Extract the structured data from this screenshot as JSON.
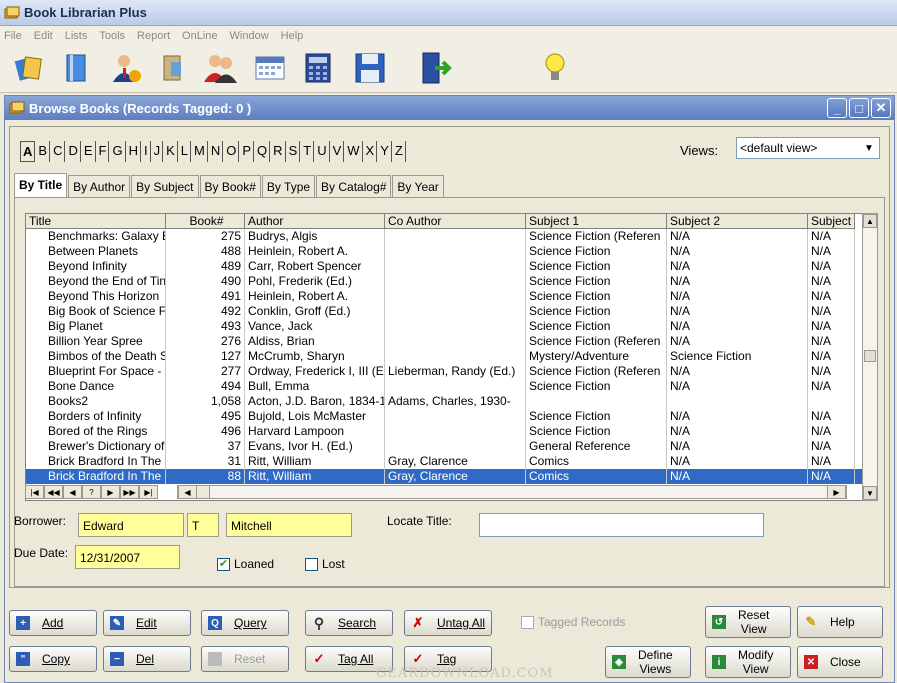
{
  "app": {
    "title": "Book Librarian Plus"
  },
  "menu": [
    "File",
    "Edit",
    "Lists",
    "Tools",
    "Report",
    "OnLine",
    "Window",
    "Help"
  ],
  "toolbar": {
    "buttons": [
      "books-icon",
      "book-icon",
      "person-info-icon",
      "book-open-icon",
      "people-icon",
      "calendar-icon",
      "calculator-icon",
      "floppy-disk-icon",
      "exit-door-icon",
      "lightbulb-icon"
    ]
  },
  "window": {
    "title": "Browse Books  (Records Tagged:  0 )",
    "min": "_",
    "max": "□",
    "close": "✕"
  },
  "alphabet": [
    "A",
    "B",
    "C",
    "D",
    "E",
    "F",
    "G",
    "H",
    "I",
    "J",
    "K",
    "L",
    "M",
    "N",
    "O",
    "P",
    "Q",
    "R",
    "S",
    "T",
    "U",
    "V",
    "W",
    "X",
    "Y",
    "Z"
  ],
  "views": {
    "label": "Views:",
    "value": "<default view>"
  },
  "tabs": [
    "By Title",
    "By Author",
    "By Subject",
    "By Book#",
    "By Type",
    "By Catalog#",
    "By Year"
  ],
  "grid": {
    "columns": [
      "Title",
      "Book#",
      "Author",
      "Co Author",
      "Subject 1",
      "Subject 2",
      "Subject"
    ],
    "rows": [
      [
        "Benchmarks: Galaxy B",
        "275",
        "Budrys, Algis",
        "",
        "Science Fiction (Referen",
        "N/A",
        "N/A"
      ],
      [
        "Between Planets",
        "488",
        "Heinlein, Robert A.",
        "",
        "Science Fiction",
        "N/A",
        "N/A"
      ],
      [
        "Beyond Infinity",
        "489",
        "Carr, Robert Spencer",
        "",
        "Science Fiction",
        "N/A",
        "N/A"
      ],
      [
        "Beyond the End of Tin",
        "490",
        "Pohl, Frederik (Ed.)",
        "",
        "Science Fiction",
        "N/A",
        "N/A"
      ],
      [
        "Beyond This Horizon",
        "491",
        "Heinlein, Robert A.",
        "",
        "Science Fiction",
        "N/A",
        "N/A"
      ],
      [
        "Big Book of Science F",
        "492",
        "Conklin, Groff (Ed.)",
        "",
        "Science Fiction",
        "N/A",
        "N/A"
      ],
      [
        "Big Planet",
        "493",
        "Vance, Jack",
        "",
        "Science Fiction",
        "N/A",
        "N/A"
      ],
      [
        "Billion Year Spree",
        "276",
        "Aldiss, Brian",
        "",
        "Science Fiction (Referen",
        "N/A",
        "N/A"
      ],
      [
        "Bimbos of the Death S",
        "127",
        "McCrumb, Sharyn",
        "",
        "Mystery/Adventure",
        "Science Fiction",
        "N/A"
      ],
      [
        "Blueprint For Space -",
        "277",
        "Ordway, Frederick I, III (Ec",
        "Lieberman, Randy (Ed.)",
        "Science Fiction (Referen",
        "N/A",
        "N/A"
      ],
      [
        "Bone Dance",
        "494",
        "Bull, Emma",
        "",
        "Science Fiction",
        "N/A",
        "N/A"
      ],
      [
        "Books2",
        "1,058",
        "Acton, J.D. Baron, 1834-1",
        "Adams, Charles, 1930-",
        "",
        "",
        ""
      ],
      [
        "Borders of Infinity",
        "495",
        "Bujold, Lois McMaster",
        "",
        "Science Fiction",
        "N/A",
        "N/A"
      ],
      [
        "Bored of the Rings",
        "496",
        "Harvard Lampoon",
        "",
        "Science Fiction",
        "N/A",
        "N/A"
      ],
      [
        "Brewer's Dictionary of",
        "37",
        "Evans, Ivor H. (Ed.)",
        "",
        "General Reference",
        "N/A",
        "N/A"
      ],
      [
        "Brick Bradford In The",
        "31",
        "Ritt, William",
        "Gray, Clarence",
        "Comics",
        "N/A",
        "N/A"
      ],
      [
        "Brick Bradford In The",
        "88",
        "Ritt, William",
        "Gray, Clarence",
        "Comics",
        "N/A",
        "N/A"
      ]
    ],
    "selected_index": 16
  },
  "navigator": [
    "|◀",
    "◀◀",
    "◀",
    "?",
    "▶",
    "▶▶",
    "▶|"
  ],
  "form": {
    "borrower_label": "Borrower:",
    "borrower_first": "Edward",
    "borrower_middle": "T",
    "borrower_last": "Mitchell",
    "locate_label": "Locate Title:",
    "locate_value": "",
    "due_label": "Due Date:",
    "due_value": "12/31/2007",
    "loaned_label": "Loaned",
    "loaned_checked": true,
    "lost_label": "Lost",
    "lost_checked": false,
    "tagged_label": "Tagged Records"
  },
  "buttons": {
    "add": "Add",
    "edit": "Edit",
    "query": "Query",
    "search": "Search",
    "untag_all": "Untag All",
    "copy": "Copy",
    "del": "Del",
    "reset": "Reset",
    "tag_all": "Tag All",
    "tag": "Tag",
    "reset_view_1": "Reset",
    "reset_view_2": "View",
    "help": "Help",
    "define_views_1": "Define",
    "define_views_2": "Views",
    "modify_view_1": "Modify",
    "modify_view_2": "View",
    "close": "Close"
  },
  "watermark": "GEARDOWNLOAD.COM",
  "colors": {
    "accent": "#316ac5",
    "field_yellow": "#ffff99"
  }
}
